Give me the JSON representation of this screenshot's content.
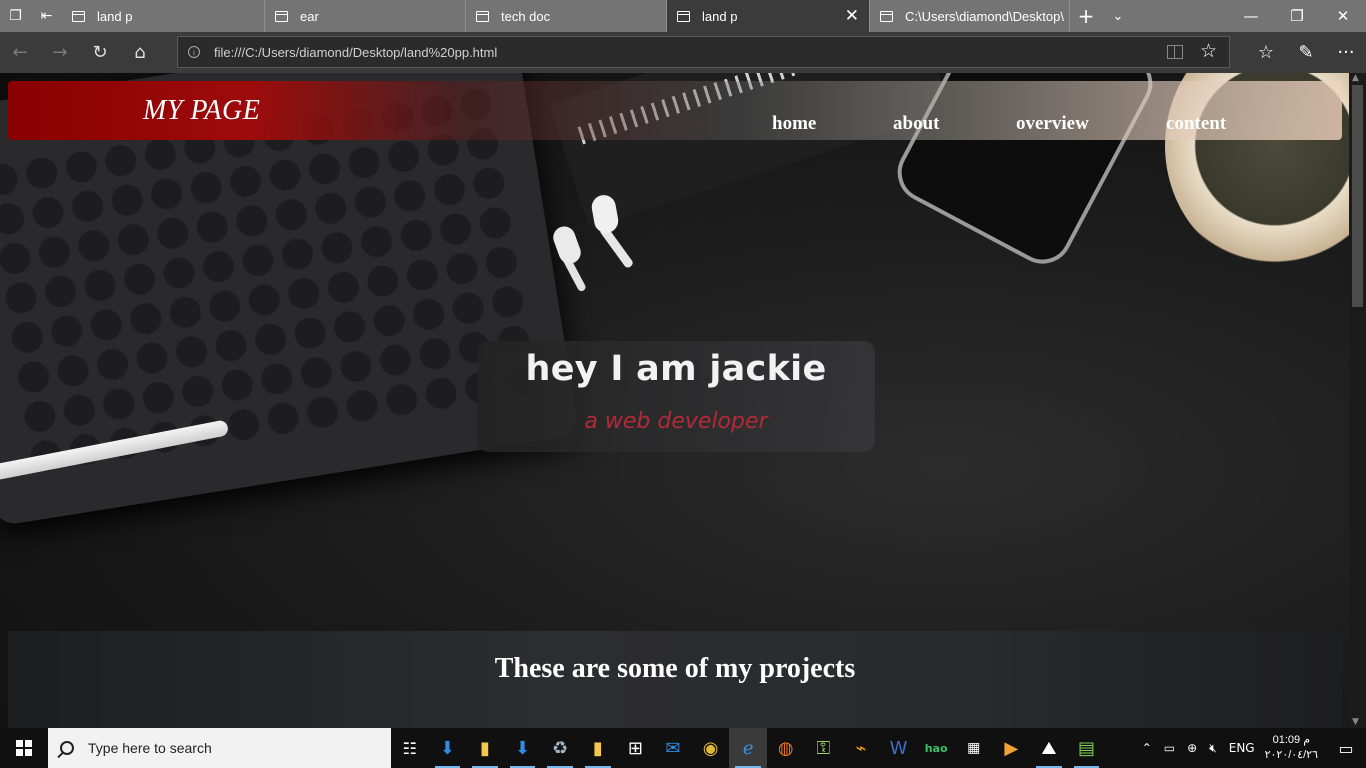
{
  "browser": {
    "tabs": [
      {
        "label": "land p",
        "active": false
      },
      {
        "label": "ear",
        "active": false
      },
      {
        "label": "tech doc",
        "active": false
      },
      {
        "label": "land p",
        "active": true
      },
      {
        "label": "C:\\Users\\diamond\\Desktop\\",
        "active": false
      }
    ],
    "new_tab_glyph": "+",
    "tab_list_glyph": "⌄",
    "window_controls": {
      "minimize": "—",
      "restore": "❐",
      "close": "✕"
    },
    "address": {
      "url": "file:///C:/Users/diamond/Desktop/land%20pp.html"
    },
    "icons": {
      "back": "←",
      "forward": "→",
      "refresh": "↻",
      "home": "⌂",
      "favorite": "☆",
      "favorites_hub": "☆",
      "notes": "✎",
      "more": "···"
    }
  },
  "page": {
    "logo": "MY PAGE",
    "nav": [
      "home",
      "about",
      "overview",
      "content"
    ],
    "hero": {
      "title": "hey I am jackie",
      "subtitle": "a web developer"
    },
    "projects_heading": "These are some of my projects"
  },
  "taskbar": {
    "search_placeholder": "Type here to search",
    "apps": [
      "task-view",
      "download",
      "file-explorer",
      "download",
      "recycle-bin",
      "folder",
      "store",
      "mail",
      "chrome",
      "edge",
      "firefox",
      "usb",
      "app",
      "word",
      "hao123",
      "calendar",
      "media-player",
      "photos",
      "taskmanager"
    ],
    "language": "ENG",
    "time": "01:09 م",
    "date": "٢٠٢٠/٠٤/٢٦"
  },
  "colors": {
    "brand_red": "#9e0b0b",
    "subtitle_red": "#b22a38",
    "accent_blue": "#76b9ed"
  }
}
